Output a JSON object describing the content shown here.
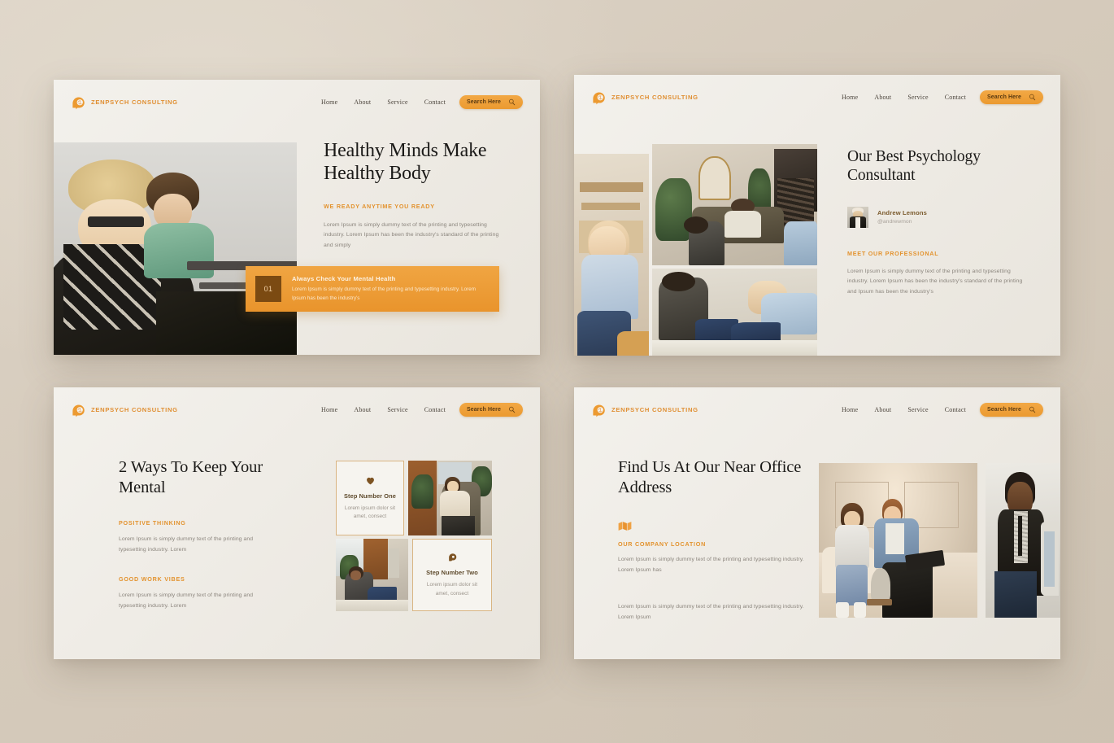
{
  "theme": {
    "accent": "#eb9a30",
    "accent_light": "#f2a845",
    "accent_dark": "#7b4a12",
    "page_bg": "#d5cabb",
    "slide_bg": "#f1eee8",
    "heading_color": "#1b1a18",
    "body_color": "#8b857d",
    "card_border": "#d9b583"
  },
  "brand": {
    "name": "ZENPSYCH CONSULTING",
    "logo_icon": "head-profile-brain-icon"
  },
  "nav": {
    "links": [
      "Home",
      "About",
      "Service",
      "Contact"
    ],
    "search_label": "Search Here",
    "search_icon": "magnifier-icon"
  },
  "slides": [
    {
      "id": "slide-hero",
      "title": "Healthy Minds Make Healthy Body",
      "eyebrow": "WE READY ANYTIME YOU READY",
      "body": "Lorem Ipsum is simply dummy text of the printing and typesetting industry. Lorem Ipsum has been the industry's standard of the printing and simply",
      "callout": {
        "number": "01",
        "title": "Always Check Your Mental Health",
        "body": "Lorem Ipsum is simply dummy text of the printing and typesetting industry. Lorem Ipsum has been the industry's"
      },
      "photo_alt": "two-women-in-therapy-session-photo"
    },
    {
      "id": "slide-consultant",
      "title": "Our Best Psychology Consultant",
      "person": {
        "name": "Andrew Lemons",
        "handle": "@andrewmon",
        "avatar_alt": "consultant-portrait-photo"
      },
      "eyebrow": "MEET OUR PROFESSIONAL",
      "body": "Lorem Ipsum is simply dummy text of the printing and typesetting industry. Lorem Ipsum has been the industry's standard of the printing and Ipsum has been the industry's",
      "gallery": [
        "woman-sitting-on-floor-photo",
        "group-therapy-living-room-photo",
        "two-people-talking-on-couch-photo"
      ]
    },
    {
      "id": "slide-ways",
      "title": "2 Ways To Keep Your Mental",
      "sections": [
        {
          "eyebrow": "POSITIVE THINKING",
          "body": "Lorem Ipsum is simply dummy text of the printing and typesetting industry. Lorem"
        },
        {
          "eyebrow": "GOOD WORK VIBES",
          "body": "Lorem Ipsum is simply dummy text of the printing and typesetting industry. Lorem"
        }
      ],
      "steps": [
        {
          "icon": "heart-icon",
          "title": "Step Number One",
          "body": "Lorem ipsum dolor sit amet, consect"
        },
        {
          "icon": "head-profile-icon",
          "title": "Step Number Two",
          "body": "Lorem ipsum dolor sit amet, consect"
        }
      ],
      "photos": [
        "woman-reading-in-armchair-photo",
        "man-sitting-on-couch-photo"
      ]
    },
    {
      "id": "slide-location",
      "title": "Find Us At Our Near Office Address",
      "map_icon": "folded-map-icon",
      "eyebrow": "OUR COMPANY LOCATION",
      "body_1": "Lorem Ipsum is simply dummy text of the printing and typesetting industry. Lorem Ipsum has",
      "body_2": "Lorem Ipsum is simply dummy text of the printing and typesetting industry. Lorem Ipsum",
      "photos": [
        "couple-consultation-on-sofa-photo",
        "man-in-suit-seated-photo"
      ]
    }
  ]
}
